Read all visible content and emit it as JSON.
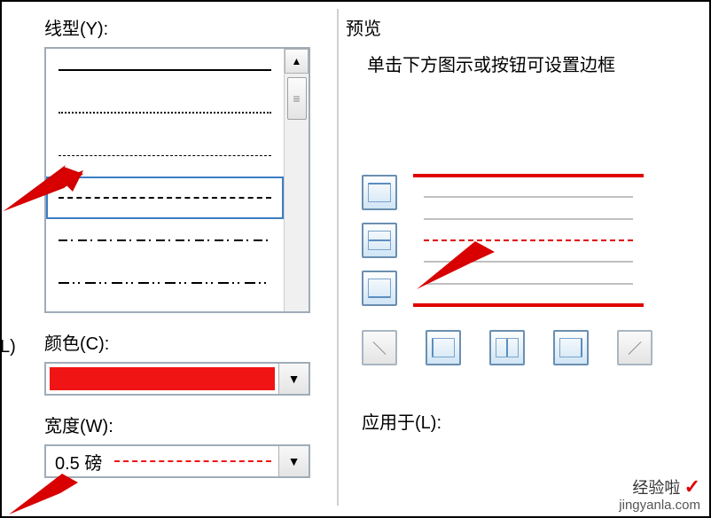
{
  "labels": {
    "linetype": "线型(Y):",
    "color": "颜色(C):",
    "width": "宽度(W):",
    "preview": "预览",
    "preview_hint": "单击下方图示或按钮可设置边框",
    "apply_to": "应用于(L):",
    "width_value": "0.5  磅",
    "cut_label": "L)"
  },
  "watermark": {
    "brand": "经验啦",
    "check": "✓",
    "url": "jingyanla.com"
  },
  "colors": {
    "color_value": "#f01414"
  }
}
